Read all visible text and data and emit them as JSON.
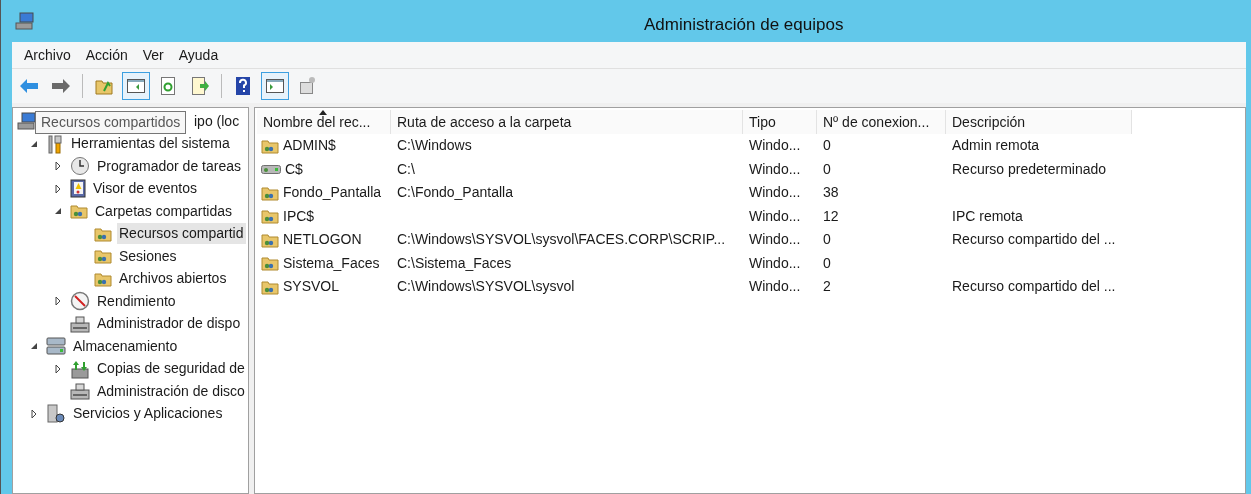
{
  "window": {
    "title": "Administración de equipos"
  },
  "menu": [
    "Archivo",
    "Acción",
    "Ver",
    "Ayuda"
  ],
  "toolbar": [
    {
      "pressed": false
    },
    {
      "pressed": false
    },
    {
      "pressed": false
    },
    {
      "pressed": true
    },
    {
      "pressed": false
    },
    {
      "pressed": false
    },
    {
      "pressed": false
    },
    {
      "pressed": true
    },
    {
      "pressed": false
    }
  ],
  "tooltip": "Recursos compartidos",
  "tree": [
    {
      "label": "ipo (loc",
      "selected": false,
      "children": [
        {
          "label": "Herramientas del sistema",
          "expanded": true,
          "selected": false,
          "children": [
            {
              "label": "Programador de tareas",
              "expanded": false,
              "selected": false
            },
            {
              "label": "Visor de eventos",
              "expanded": false,
              "selected": false
            },
            {
              "label": "Carpetas compartidas",
              "expanded": true,
              "selected": false,
              "children": [
                {
                  "label": "Recursos compartid",
                  "selected": true
                },
                {
                  "label": "Sesiones",
                  "selected": false
                },
                {
                  "label": "Archivos abiertos",
                  "selected": false
                }
              ]
            },
            {
              "label": "Rendimiento",
              "expanded": false,
              "selected": false
            },
            {
              "label": "Administrador de dispo",
              "selected": false
            }
          ]
        },
        {
          "label": "Almacenamiento",
          "expanded": true,
          "selected": false,
          "children": [
            {
              "label": "Copias de seguridad de",
              "expanded": false,
              "selected": false
            },
            {
              "label": "Administración de disco",
              "selected": false
            }
          ]
        },
        {
          "label": "Servicios y Aplicaciones",
          "expanded": false,
          "selected": false
        }
      ]
    }
  ],
  "table": {
    "columns": [
      {
        "label": "Nombre del rec...",
        "sorted": true
      },
      {
        "label": "Ruta de acceso a la carpeta",
        "sorted": false
      },
      {
        "label": "Tipo",
        "sorted": false
      },
      {
        "label": "Nº de conexion...",
        "sorted": false
      },
      {
        "label": "Descripción",
        "sorted": false
      }
    ],
    "rows": [
      {
        "kind": "folder",
        "cells": [
          "ADMIN$",
          "C:\\Windows",
          "Windo...",
          "0",
          "Admin remota"
        ]
      },
      {
        "kind": "drive",
        "cells": [
          "C$",
          "C:\\",
          "Windo...",
          "0",
          "Recurso predeterminado"
        ]
      },
      {
        "kind": "folder",
        "cells": [
          "Fondo_Pantalla",
          "C:\\Fondo_Pantalla",
          "Windo...",
          "38",
          ""
        ]
      },
      {
        "kind": "folder",
        "cells": [
          "IPC$",
          "",
          "Windo...",
          "12",
          "IPC remota"
        ]
      },
      {
        "kind": "folder",
        "cells": [
          "NETLOGON",
          "C:\\Windows\\SYSVOL\\sysvol\\FACES.CORP\\SCRIP...",
          "Windo...",
          "0",
          "Recurso compartido del ..."
        ]
      },
      {
        "kind": "folder",
        "cells": [
          "Sistema_Faces",
          "C:\\Sistema_Faces",
          "Windo...",
          "0",
          ""
        ]
      },
      {
        "kind": "folder",
        "cells": [
          "SYSVOL",
          "C:\\Windows\\SYSVOL\\sysvol",
          "Windo...",
          "2",
          "Recurso compartido del ..."
        ]
      }
    ]
  }
}
